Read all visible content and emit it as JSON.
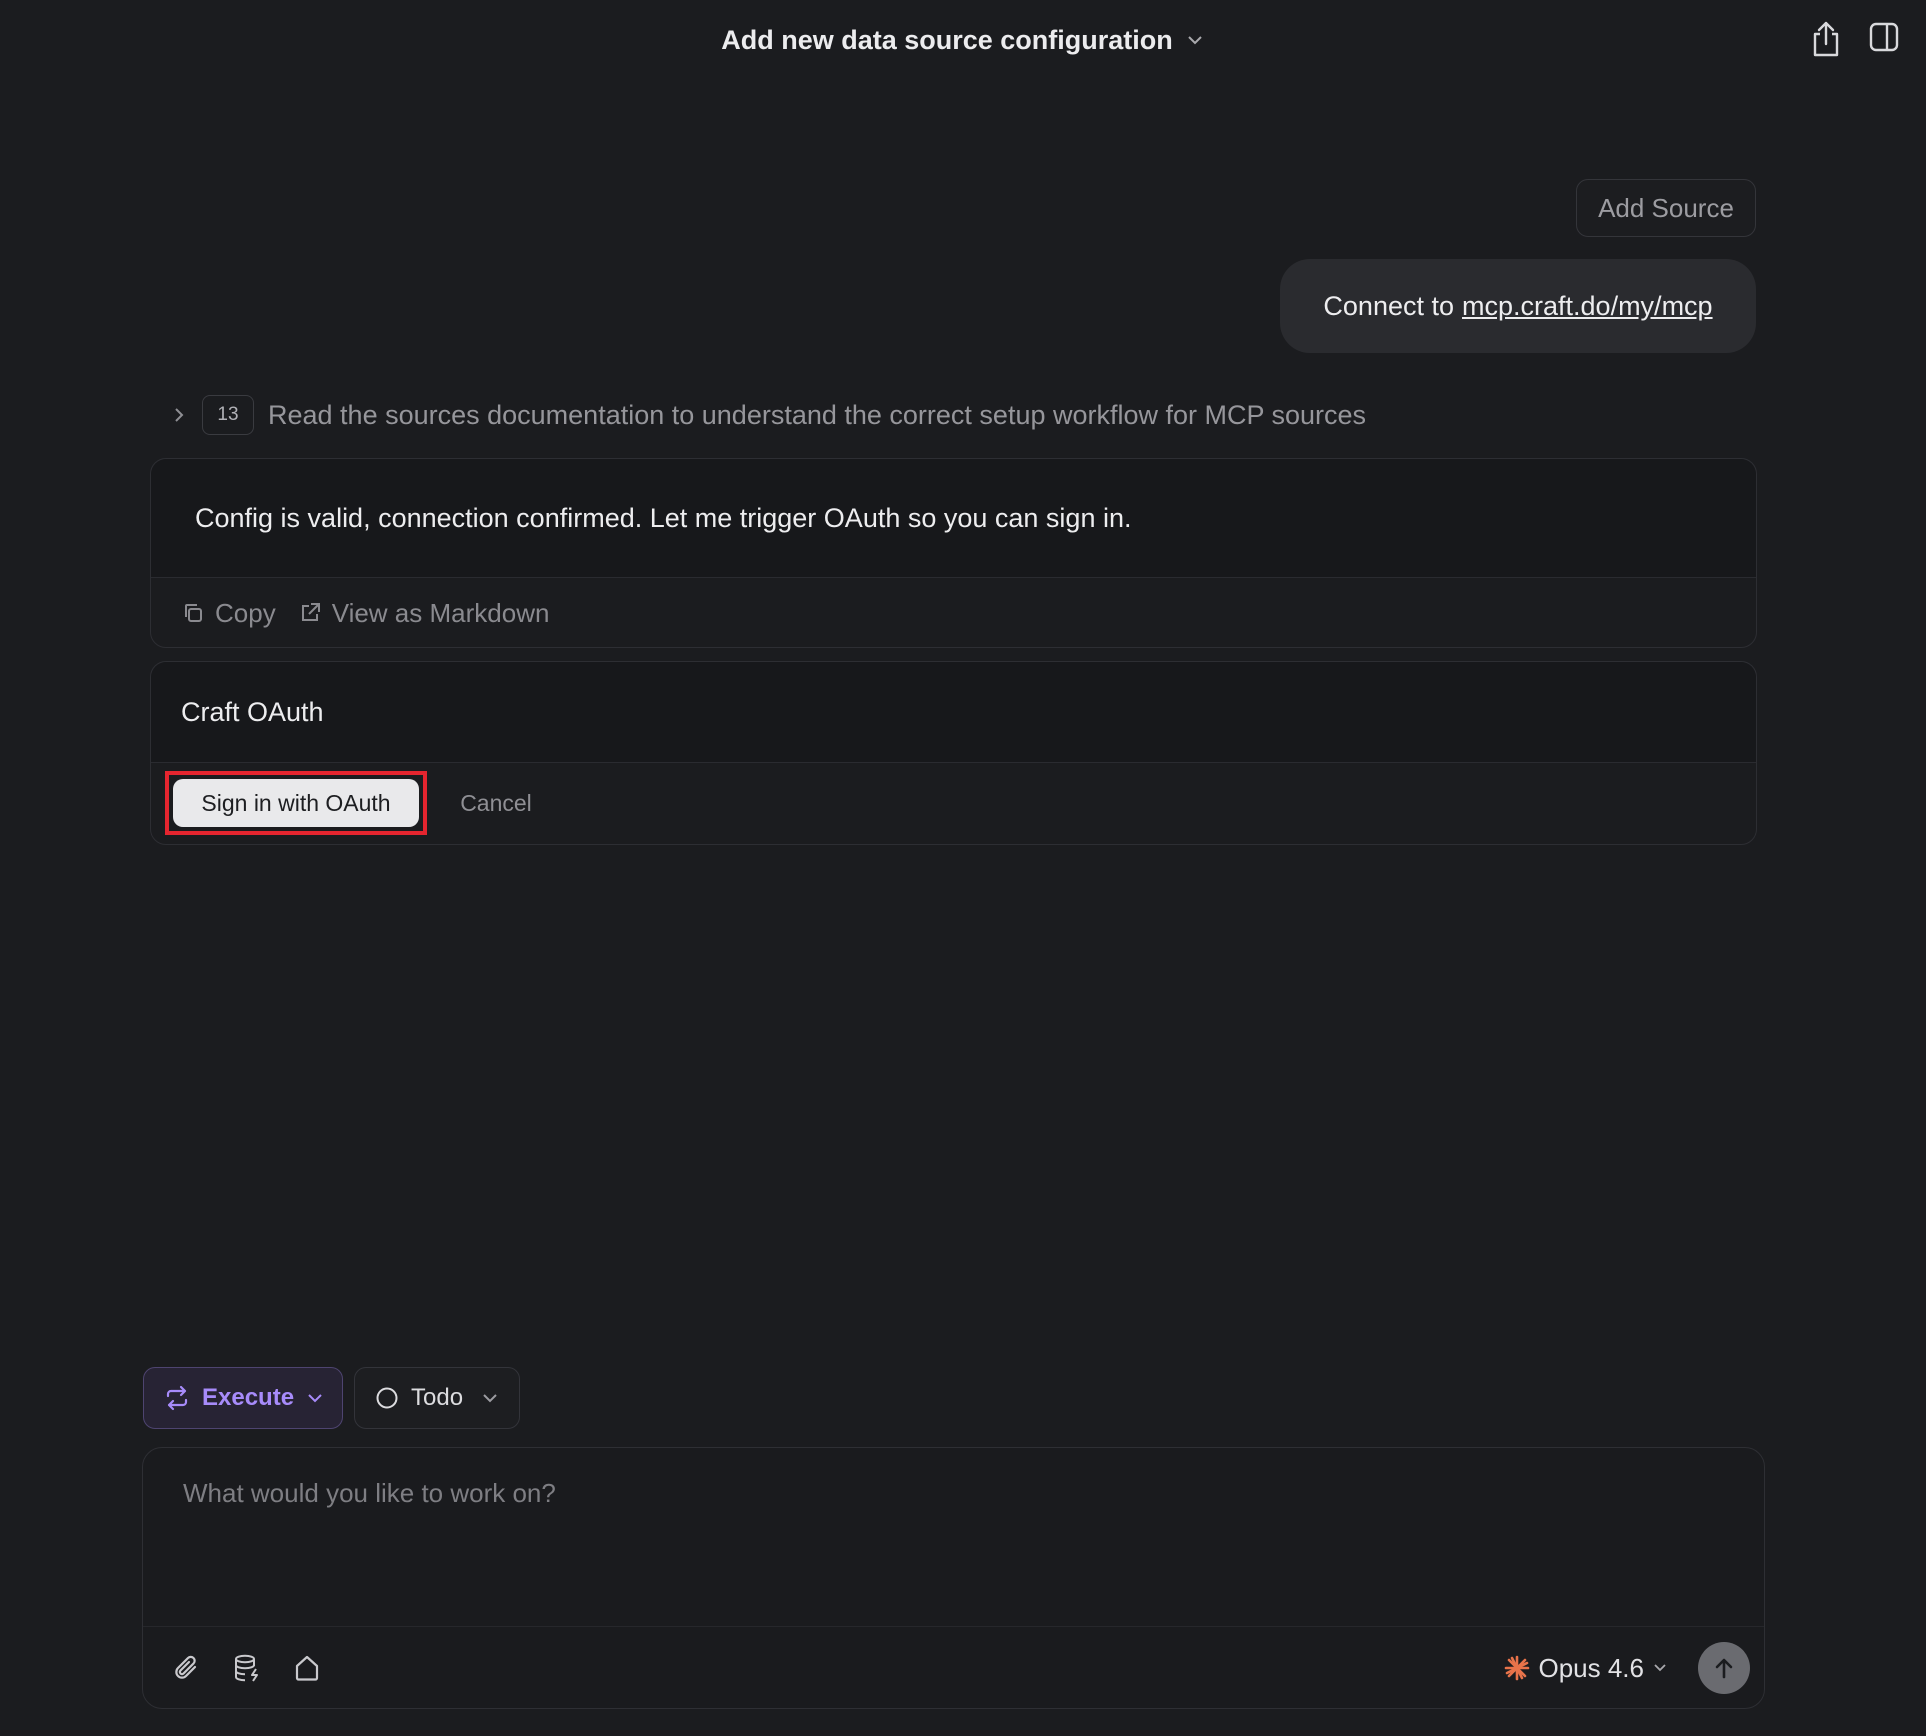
{
  "header": {
    "title": "Add new data source configuration"
  },
  "chat": {
    "add_source_chip": "Add Source",
    "user_message": {
      "prefix": "Connect to",
      "link": "mcp.craft.do/my/mcp"
    },
    "steps": {
      "count": "13",
      "summary": "Read the sources documentation to understand the correct setup workflow for MCP sources"
    },
    "assistant_message": {
      "text": "Config is valid, connection confirmed. Let me trigger OAuth so you can sign in.",
      "copy_label": "Copy",
      "markdown_label": "View as Markdown"
    },
    "oauth": {
      "title": "Craft OAuth",
      "signin_label": "Sign in with OAuth",
      "cancel_label": "Cancel"
    }
  },
  "composer": {
    "mode_label": "Execute",
    "status_label": "Todo",
    "placeholder": "What would you like to work on?",
    "model_label": "Opus 4.6"
  },
  "colors": {
    "accent_purple": "#a78bfa",
    "highlight_red": "#e5252f",
    "model_icon": "#e8734a"
  },
  "icons": [
    "chevron-down-icon",
    "share-icon",
    "sidebar-toggle-icon",
    "chevron-right-icon",
    "copy-icon",
    "external-link-icon",
    "repeat-icon",
    "circle-icon",
    "paperclip-icon",
    "database-icon",
    "home-icon",
    "sparkle-icon",
    "arrow-up-icon"
  ]
}
